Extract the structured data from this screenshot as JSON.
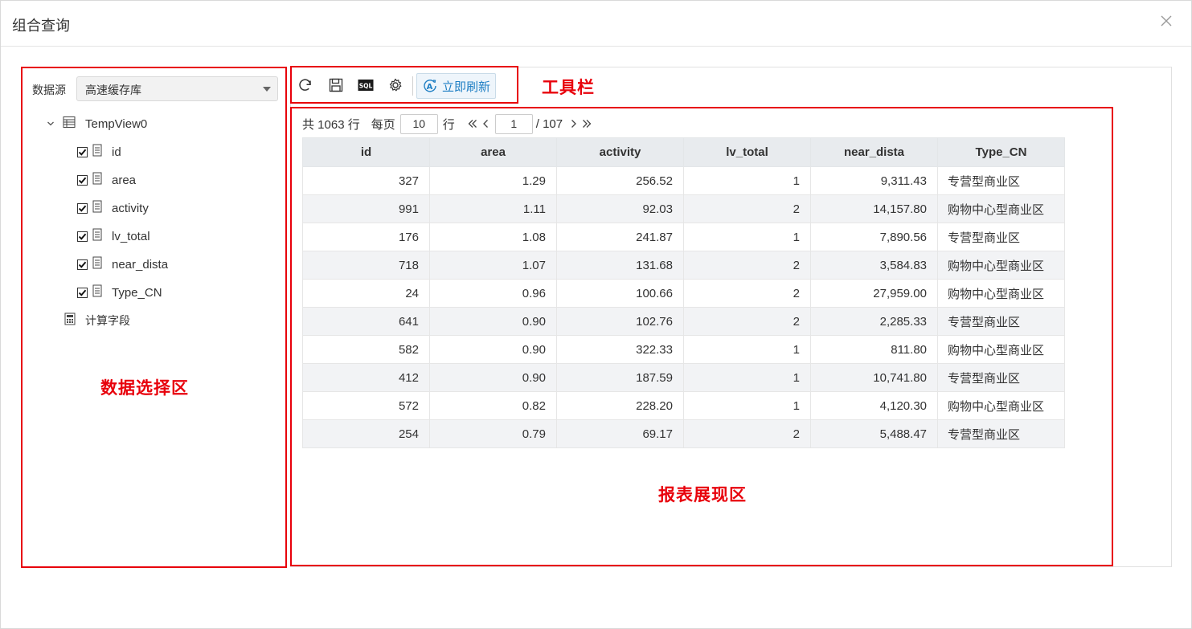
{
  "dialog": {
    "title": "组合查询"
  },
  "datasource": {
    "label": "数据源",
    "selected": "高速缓存库"
  },
  "tree": {
    "table_name": "TempView0",
    "fields": [
      {
        "name": "id",
        "checked": true
      },
      {
        "name": "area",
        "checked": true
      },
      {
        "name": "activity",
        "checked": true
      },
      {
        "name": "lv_total",
        "checked": true
      },
      {
        "name": "near_dista",
        "checked": true
      },
      {
        "name": "Type_CN",
        "checked": true
      }
    ],
    "calc_field": "计算字段"
  },
  "toolbar": {
    "refresh_label": "立即刷新"
  },
  "pager": {
    "total_prefix": "共 1063 行",
    "per_page_label": "每页",
    "per_page_value": "10",
    "row_unit": "行",
    "current_page": "1",
    "total_pages": "/ 107"
  },
  "table": {
    "columns": [
      "id",
      "area",
      "activity",
      "lv_total",
      "near_dista",
      "Type_CN"
    ],
    "rows": [
      [
        "327",
        "1.29",
        "256.52",
        "1",
        "9,311.43",
        "专营型商业区"
      ],
      [
        "991",
        "1.11",
        "92.03",
        "2",
        "14,157.80",
        "购物中心型商业区"
      ],
      [
        "176",
        "1.08",
        "241.87",
        "1",
        "7,890.56",
        "专营型商业区"
      ],
      [
        "718",
        "1.07",
        "131.68",
        "2",
        "3,584.83",
        "购物中心型商业区"
      ],
      [
        "24",
        "0.96",
        "100.66",
        "2",
        "27,959.00",
        "购物中心型商业区"
      ],
      [
        "641",
        "0.90",
        "102.76",
        "2",
        "2,285.33",
        "专营型商业区"
      ],
      [
        "582",
        "0.90",
        "322.33",
        "1",
        "811.80",
        "购物中心型商业区"
      ],
      [
        "412",
        "0.90",
        "187.59",
        "1",
        "10,741.80",
        "专营型商业区"
      ],
      [
        "572",
        "0.82",
        "228.20",
        "1",
        "4,120.30",
        "购物中心型商业区"
      ],
      [
        "254",
        "0.79",
        "69.17",
        "2",
        "5,488.47",
        "专营型商业区"
      ]
    ]
  },
  "annotations": {
    "toolbar": "工具栏",
    "data_select": "数据选择区",
    "report": "报表展现区"
  },
  "colors": {
    "annotation": "#e8000b",
    "accent": "#1f7fc4",
    "header_bg": "#e8ebee"
  },
  "icons": {
    "refresh": "refresh-icon",
    "save": "save-icon",
    "sql": "sql-icon",
    "settings": "gear-icon",
    "close": "close-icon",
    "table": "table-icon",
    "field": "field-icon",
    "calc": "calculator-icon"
  }
}
